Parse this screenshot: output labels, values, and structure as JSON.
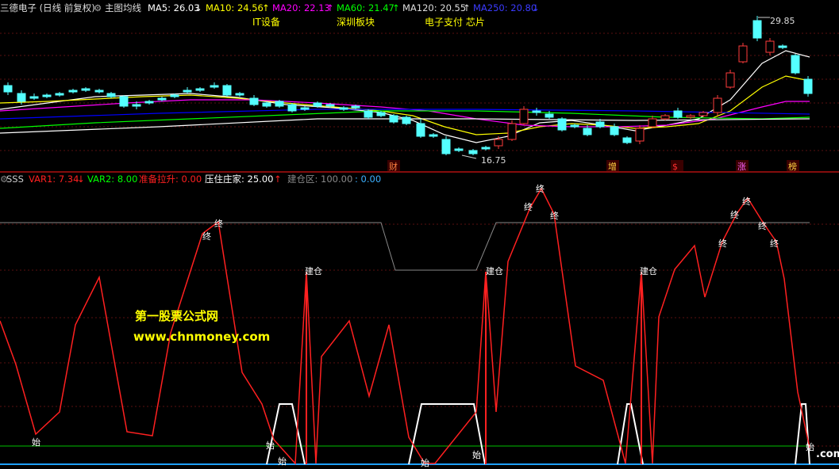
{
  "header": {
    "stock_name": "三德电子 (日线 前复权)",
    "indicator_label": "主图均线",
    "ma5": "MA5: 26.03",
    "ma10": "MA10: 24.56",
    "ma20": "MA20: 22.13",
    "ma60": "MA60: 21.47",
    "ma120": "MA120: 20.55",
    "ma250": "MA250: 20.80",
    "up_arrow": "↑",
    "down_arrow": "↓"
  },
  "tags": {
    "it": "IT设备",
    "shenzhen": "深圳板块",
    "epay": "电子支付 芯片"
  },
  "main_annotations": {
    "high_price": "29.85",
    "low_price": "16.75",
    "markers": [
      "财",
      "增",
      "$",
      "涨",
      "榜"
    ]
  },
  "sub_header": {
    "name": "SSS",
    "var1": "VAR1: 7.34",
    "var2": "VAR2: 8.00",
    "lift": "准备拉升: 0.00",
    "press": "压住庄家: 25.00",
    "build_zone": "建仓区: 100.00",
    "build_val": ": 0.00",
    "up_arrow": "↑",
    "down_arrow": "↓"
  },
  "sub_labels": {
    "end": "终",
    "start": "始",
    "build": "建仓"
  },
  "watermark": {
    "line1": "第一股票公式网",
    "line2": "www.chnmoney.com",
    "corner": ".com"
  },
  "colors": {
    "ma5": "#ffffff",
    "ma10": "#ffff00",
    "ma20": "#ff00ff",
    "ma60": "#00ff00",
    "ma120": "#ffffff",
    "ma250": "#0000ff",
    "up_candle": "#ff3c3c",
    "down_candle": "#54ffff",
    "var1": "#ff2020",
    "var2": "#00ff00"
  }
}
